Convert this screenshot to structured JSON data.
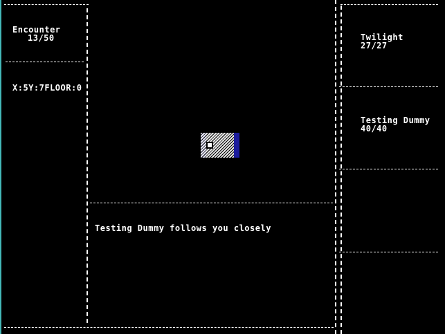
{
  "left_panel": {
    "encounter_label": "Encounter",
    "encounter_value": "13/50",
    "position_readout": "X:5Y:7FLOOR:0"
  },
  "right_panel": {
    "party": [
      {
        "name": "Twilight",
        "hp": "27/27"
      },
      {
        "name": "Testing Dummy",
        "hp": "40/40"
      }
    ]
  },
  "message_log": {
    "lines": [
      "Testing Dummy follows you closely"
    ]
  },
  "colors": {
    "border": "#ffffff",
    "wall": "#1c1c9c",
    "left_edge": "#44b8b8",
    "background": "#000000"
  }
}
